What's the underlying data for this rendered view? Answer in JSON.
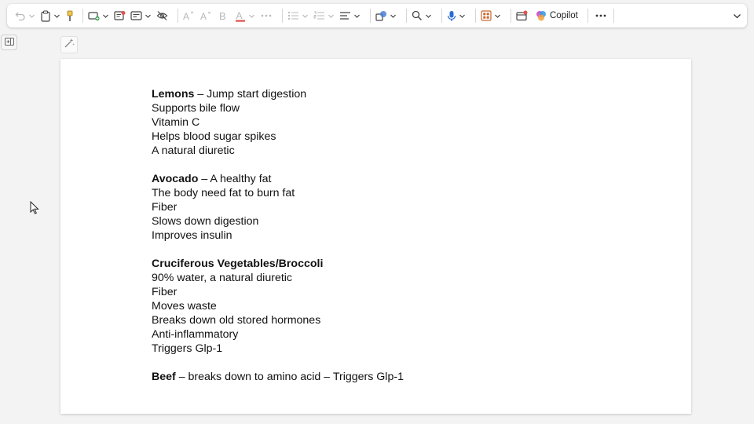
{
  "toolbar": {
    "copilot_label": "Copilot",
    "icons": [
      "undo-icon",
      "clipboard-icon",
      "format-painter-icon",
      "insert-icon",
      "sticky-note-icon",
      "form-icon",
      "hide-icon",
      "font-size-up-icon",
      "font-size-down-icon",
      "bold-icon",
      "font-color-icon",
      "more-icon",
      "bullet-list-icon",
      "numbered-list-icon",
      "align-icon",
      "shapes-icon",
      "search-icon",
      "microphone-icon",
      "grid-icon",
      "add-page-icon",
      "copilot-icon",
      "more-options-icon",
      "collapse-icon"
    ]
  },
  "document": {
    "sections": [
      {
        "heading": "Lemons",
        "heading_suffix": " – Jump start digestion",
        "items": [
          "Supports bile flow",
          "Vitamin C",
          "Helps blood sugar spikes",
          "A natural diuretic"
        ]
      },
      {
        "heading": "Avocado",
        "heading_suffix": " – A healthy fat",
        "items": [
          "The body need fat to burn fat",
          "Fiber",
          "Slows down digestion",
          "Improves insulin"
        ]
      },
      {
        "heading": "Cruciferous Vegetables/Broccoli",
        "heading_suffix": "",
        "items": [
          "90% water, a natural diuretic",
          "Fiber",
          "Moves waste",
          "Breaks down old stored hormones",
          "Anti-inflammatory",
          "Triggers Glp-1"
        ]
      },
      {
        "heading": "Beef",
        "heading_suffix": " – breaks down to amino acid – Triggers Glp-1",
        "items": []
      }
    ]
  },
  "colors": {
    "background": "#f3f3f3",
    "page": "#ffffff",
    "text": "#111111",
    "font_color_underline": "#e0524f",
    "microphone": "#2b6cd4",
    "grid_icon": "#c7672e"
  }
}
